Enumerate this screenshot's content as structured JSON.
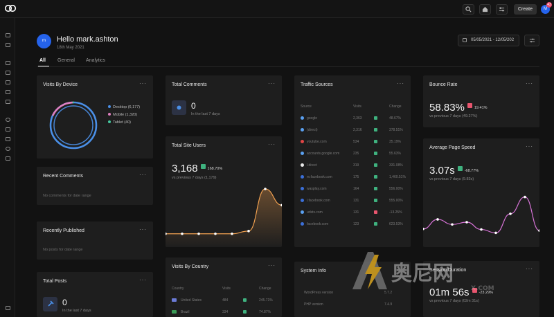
{
  "topbar": {
    "create_label": "Create",
    "user_initial": "M",
    "notification_count": "43"
  },
  "header": {
    "greeting": "Hello mark.ashton",
    "date": "18th May 2021",
    "avatar_initial": "m",
    "date_range": "05/05/2021 - 12/05/202"
  },
  "tabs": [
    "All",
    "General",
    "Analytics"
  ],
  "visits_by_device": {
    "title": "Visits By Device",
    "legend": [
      {
        "label": "Desktop (6,177)",
        "color": "#4a8fe7"
      },
      {
        "label": "Mobile (1,320)",
        "color": "#e07fbf"
      },
      {
        "label": "Tablet (40)",
        "color": "#46c9a0"
      }
    ]
  },
  "recent_comments": {
    "title": "Recent Comments",
    "empty": "No comments for date range"
  },
  "recently_published": {
    "title": "Recently Published",
    "empty": "No posts for date range"
  },
  "total_posts": {
    "title": "Total Posts",
    "value": "0",
    "caption": "In the last 7 days"
  },
  "total_comments": {
    "title": "Total Comments",
    "value": "0",
    "caption": "In the last 7 days"
  },
  "total_site_users": {
    "title": "Total Site Users",
    "value": "3,168",
    "change": "168.70%",
    "caption": "vs previous 7 days (1,179)"
  },
  "visits_by_country": {
    "title": "Visits By Country",
    "headers": [
      "Country",
      "Visits",
      "Change"
    ],
    "rows": [
      {
        "country": "United States",
        "visits": "484",
        "change": "245.71%"
      },
      {
        "country": "Brazil",
        "visits": "334",
        "change": "74.87%"
      }
    ]
  },
  "traffic_sources": {
    "title": "Traffic Sources",
    "headers": [
      "Source",
      "Visits",
      "Change"
    ],
    "rows": [
      {
        "source": "google",
        "visits": "2,363",
        "change": "48.67%",
        "up": true,
        "color": "#5aa0f0"
      },
      {
        "source": "(direct)",
        "visits": "2,316",
        "change": "378.51%",
        "up": true,
        "color": "#5aa0f0"
      },
      {
        "source": "youtube.com",
        "visits": "534",
        "change": "35.19%",
        "up": true,
        "color": "#e04545"
      },
      {
        "source": "accounts.google.com",
        "visits": "235",
        "change": "55.63%",
        "up": true,
        "color": "#5aa0f0"
      },
      {
        "source": "l.direct",
        "visits": "319",
        "change": "331.08%",
        "up": true,
        "color": "#e8e8e8"
      },
      {
        "source": "m.facebook.com",
        "visits": "175",
        "change": "1,460.51%",
        "up": true,
        "color": "#3b6fd8"
      },
      {
        "source": "wasplay.com",
        "visits": "164",
        "change": "556.00%",
        "up": true,
        "color": "#3b6fd8"
      },
      {
        "source": "l.facebook.com",
        "visits": "131",
        "change": "555.00%",
        "up": true,
        "color": "#3b6fd8"
      },
      {
        "source": "urlsts.com",
        "visits": "131",
        "change": "-13.25%",
        "up": false,
        "color": "#5aa0f0"
      },
      {
        "source": "facebook.com",
        "visits": "123",
        "change": "623.53%",
        "up": true,
        "color": "#3b6fd8"
      }
    ]
  },
  "system_info": {
    "title": "System Info",
    "rows": [
      {
        "label": "WordPress version",
        "value": "5.7.2"
      },
      {
        "label": "PHP version",
        "value": "7.4.9"
      }
    ]
  },
  "bounce_rate": {
    "title": "Bounce Rate",
    "value": "58.83%",
    "change": "19.41%",
    "caption": "vs previous 7 days (49.27%)"
  },
  "avg_page_speed": {
    "title": "Average Page Speed",
    "value": "3.07s",
    "change": "-68.77%",
    "caption": "vs previous 7 days (9.83s)"
  },
  "session_duration": {
    "title": "Session Duration",
    "value": "01m 56s",
    "change": "-23.29%",
    "caption": "vs previous 7 days (02m 31s)"
  },
  "watermark": {
    "text": "奥尼网",
    "sub": "X.COM"
  },
  "colors": {
    "accent_blue": "#2563eb",
    "users_line": "#f0a050",
    "speed_line": "#d873d8",
    "up": "#3fb27f",
    "down": "#e8556e"
  },
  "chart_data": [
    {
      "type": "pie",
      "categories": [
        "Desktop",
        "Mobile",
        "Tablet"
      ],
      "values": [
        6177,
        1320,
        40
      ]
    },
    {
      "type": "area",
      "values": [
        0.17,
        0.17,
        0.17,
        0.17,
        0.17,
        0.22,
        1.0,
        0.7
      ]
    },
    {
      "type": "line",
      "values": [
        0.25,
        0.42,
        0.33,
        0.37,
        0.24,
        0.18,
        0.52,
        0.82,
        0.22
      ]
    }
  ]
}
